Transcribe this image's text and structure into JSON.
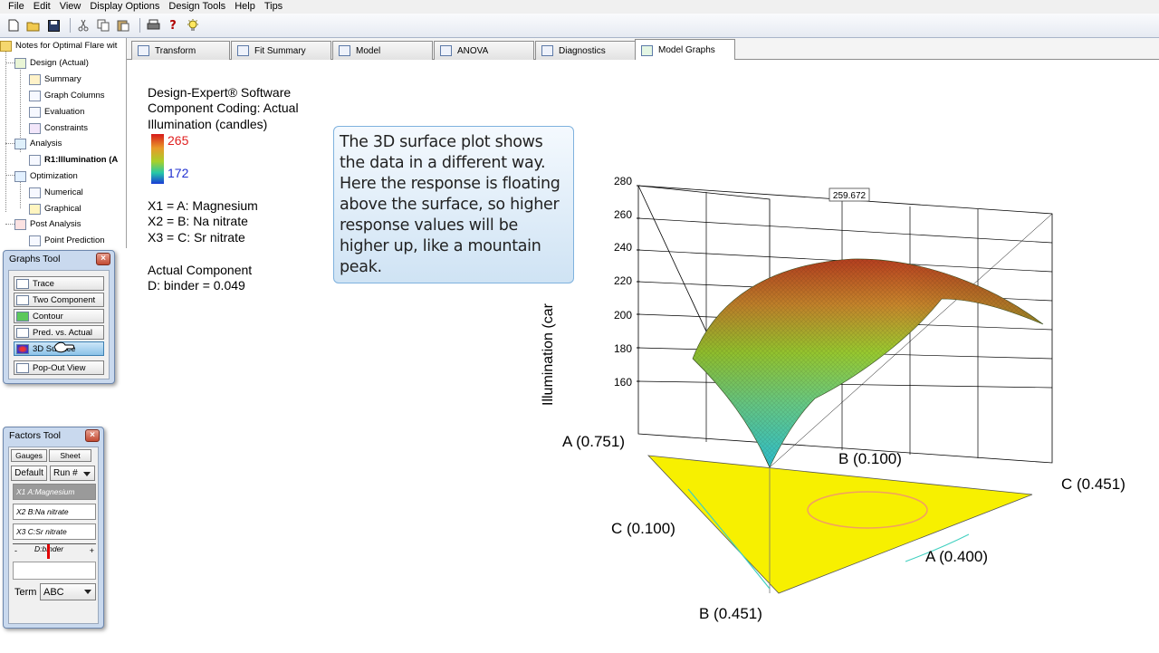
{
  "menu": {
    "items": [
      "File",
      "Edit",
      "View",
      "Display Options",
      "Design Tools",
      "Help",
      "Tips"
    ]
  },
  "toolbar": {
    "icons": [
      "new-file-icon",
      "open-folder-icon",
      "save-icon",
      "cut-icon",
      "copy-icon",
      "paste-icon",
      "print-icon",
      "help-icon",
      "tip-bulb-icon"
    ],
    "help_glyph": "?"
  },
  "tree": {
    "root": "Notes for Optimal Flare wit",
    "design": "Design (Actual)",
    "summary": "Summary",
    "graph_columns": "Graph Columns",
    "evaluation": "Evaluation",
    "constraints": "Constraints",
    "analysis": "Analysis",
    "response": "R1:Illumination (A",
    "optimization": "Optimization",
    "numerical": "Numerical",
    "graphical": "Graphical",
    "post_analysis": "Post Analysis",
    "point_prediction": "Point Prediction"
  },
  "tabs": [
    {
      "label": "Transform",
      "icon": "transform-icon"
    },
    {
      "label": "Fit Summary",
      "icon": "fit-summary-icon"
    },
    {
      "label": "Model",
      "icon": "model-icon"
    },
    {
      "label": "ANOVA",
      "icon": "anova-icon"
    },
    {
      "label": "Diagnostics",
      "icon": "diagnostics-icon"
    },
    {
      "label": "Model Graphs",
      "icon": "model-graphs-icon"
    }
  ],
  "info": {
    "software": "Design-Expert® Software",
    "coding": "Component Coding: Actual",
    "response": "Illumination (candles)",
    "legend_high": "265",
    "legend_low": "172",
    "x1": "X1 = A: Magnesium",
    "x2": "X2 = B: Na nitrate",
    "x3": "X3 = C: Sr nitrate",
    "actual_component": "Actual Component",
    "binder": "D: binder = 0.049"
  },
  "callout": {
    "text": "The 3D surface plot shows the data in a different way. Here the response is floating above the surface, so higher response values will be higher up, like a mountain peak."
  },
  "graphs_tool": {
    "title": "Graphs Tool",
    "buttons": [
      "Trace",
      "Two Component",
      "Contour",
      "Pred. vs. Actual",
      "3D Surface",
      "Pop-Out View"
    ],
    "selected": "3D Surface"
  },
  "factors_tool": {
    "title": "Factors Tool",
    "tab_gauges": "Gauges",
    "tab_sheet": "Sheet",
    "default_label": "Default",
    "run_select": "Run #",
    "factors": [
      {
        "label": "X1 A:Magnesium"
      },
      {
        "label": "X2 B:Na nitrate"
      },
      {
        "label": "X3 C:Sr nitrate"
      }
    ],
    "slider_minus": "-",
    "slider_label": "D:binder",
    "slider_plus": "+",
    "term_label": "Term",
    "term_value": "ABC"
  },
  "chart_data": {
    "type": "surface",
    "zlabel": "Illumination (car",
    "z_ticks": [
      "280",
      "260",
      "240",
      "220",
      "200",
      "180",
      "160"
    ],
    "peak_label": "259.672",
    "vertex_labels": {
      "a_high": "A (0.751)",
      "b_mid": "B (0.100)",
      "c_right": "C (0.451)",
      "c_left": "C (0.100)",
      "a_low": "A (0.400)",
      "b_bottom": "B (0.451)"
    },
    "colors": {
      "surface_high": "#b84020",
      "surface_mid": "#9acc30",
      "surface_low": "#30c8d8",
      "base_triangle": "#f7f000",
      "contour": "#f2a060"
    }
  }
}
